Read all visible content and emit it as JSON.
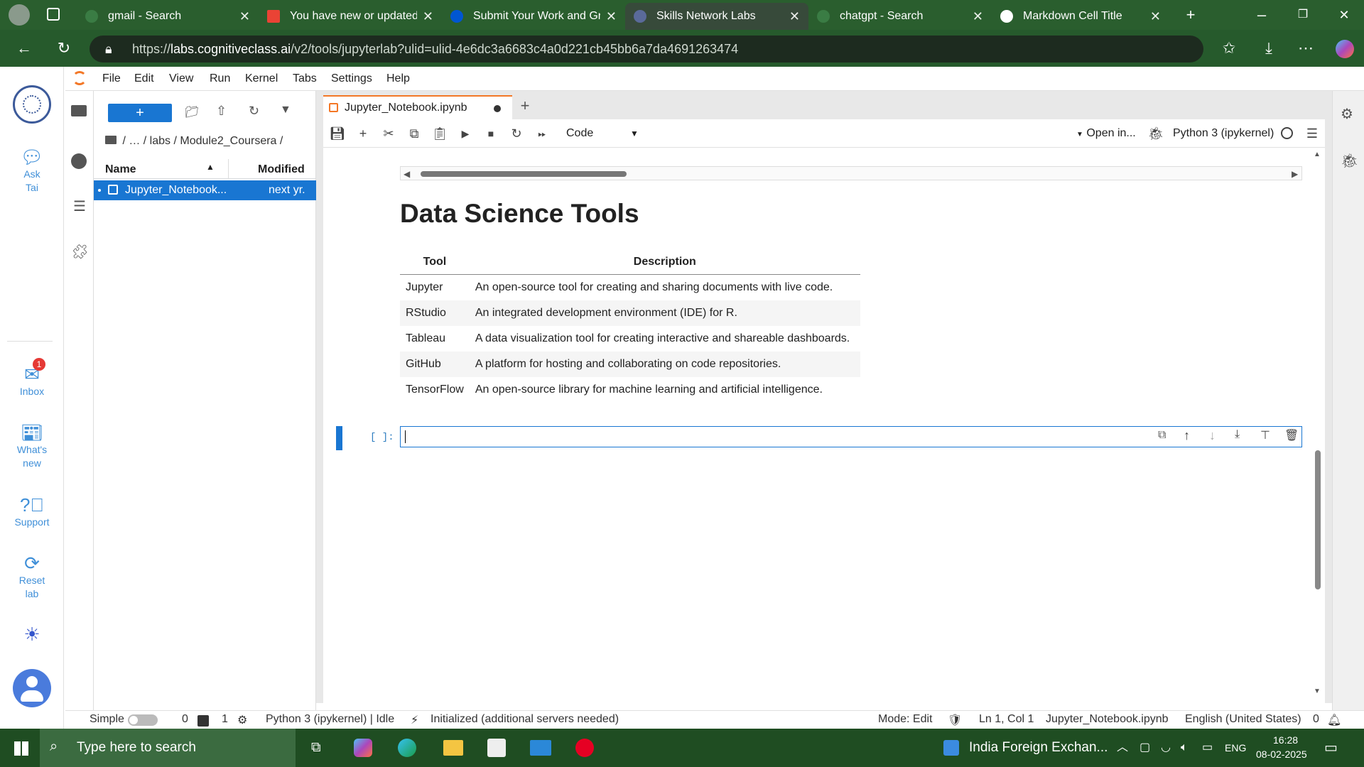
{
  "browser": {
    "tabs": [
      {
        "title": "gmail - Search",
        "icon": "search-icon"
      },
      {
        "title": "You have new or updated g",
        "icon": "gmail-icon"
      },
      {
        "title": "Submit Your Work and Grad",
        "icon": "coursera-icon"
      },
      {
        "title": "Skills Network Labs",
        "icon": "skills-network-icon",
        "active": true
      },
      {
        "title": "chatgpt - Search",
        "icon": "search-icon"
      },
      {
        "title": "Markdown Cell Title",
        "icon": "chatgpt-icon"
      }
    ],
    "url_prefix": "https://",
    "url_host": "labs.cognitiveclass.ai",
    "url_path": "/v2/tools/jupyterlab?ulid=ulid-4e6dc3a6683c4a0d221cb45bb6a7da4691263474"
  },
  "left_rail": {
    "ask_tai": "Ask Tai",
    "inbox": "Inbox",
    "inbox_badge": "1",
    "whats_new": "What's new",
    "support": "Support",
    "reset_lab": "Reset lab"
  },
  "menu": [
    "File",
    "Edit",
    "View",
    "Run",
    "Kernel",
    "Tabs",
    "Settings",
    "Help"
  ],
  "file_browser": {
    "new_button": "+",
    "breadcrumb": "/   …   / labs / Module2_Coursera /",
    "col_name": "Name",
    "col_modified": "Modified",
    "files": [
      {
        "name": "Jupyter_Notebook...",
        "modified": "next yr."
      }
    ]
  },
  "notebook": {
    "tab_title": "Jupyter_Notebook.ipynb",
    "cell_type": "Code",
    "open_in": "Open in...",
    "kernel": "Python 3 (ipykernel)",
    "heading": "Data Science Tools",
    "table": {
      "headers": [
        "Tool",
        "Description"
      ],
      "rows": [
        [
          "Jupyter",
          "An open-source tool for creating and sharing documents with live code."
        ],
        [
          "RStudio",
          "An integrated development environment (IDE) for R."
        ],
        [
          "Tableau",
          "A data visualization tool for creating interactive and shareable dashboards."
        ],
        [
          "GitHub",
          "A platform for hosting and collaborating on code repositories."
        ],
        [
          "TensorFlow",
          "An open-source library for machine learning and artificial intelligence."
        ]
      ]
    },
    "prompt": "[ ]:"
  },
  "status": {
    "mode_label": "Simple",
    "terminals": "0",
    "kernels": "1",
    "kernel_status": "Python 3 (ipykernel) | Idle",
    "server_status": "Initialized (additional servers needed)",
    "mode": "Mode: Edit",
    "position": "Ln 1, Col 1",
    "file": "Jupyter_Notebook.ipynb",
    "language": "English (United States)",
    "notifications": "0"
  },
  "taskbar": {
    "search_placeholder": "Type here to search",
    "news": "India Foreign Exchan...",
    "language": "ENG",
    "time": "16:28",
    "date": "08-02-2025"
  }
}
